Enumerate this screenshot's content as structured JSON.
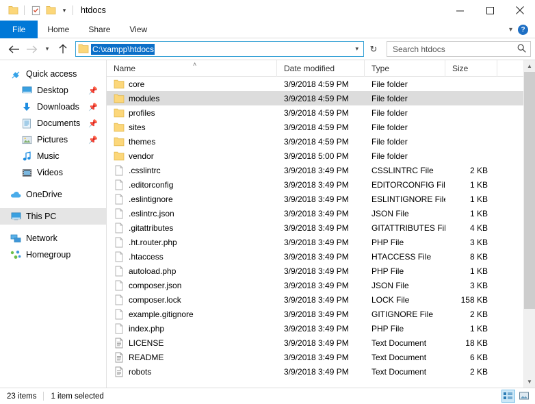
{
  "window": {
    "title": "htdocs",
    "quick_access_icons": [
      "folder-icon",
      "properties-icon",
      "new-folder-icon"
    ],
    "qat_dropdown": "chevron-down-icon",
    "controls": {
      "minimize": "—",
      "maximize": "☐",
      "close": "✕"
    }
  },
  "ribbon": {
    "tabs": [
      {
        "label": "File",
        "active": true
      },
      {
        "label": "Home",
        "active": false
      },
      {
        "label": "Share",
        "active": false
      },
      {
        "label": "View",
        "active": false
      }
    ],
    "collapse_icon": "chevron-down-icon",
    "help_icon": "?",
    "file_tab_color": "#0078d7"
  },
  "address": {
    "back_icon": "arrow-left-icon",
    "forward_icon": "arrow-right-icon",
    "recent_icon": "chevron-down-icon",
    "up_icon": "arrow-up-icon",
    "path": "C:\\xampp\\htdocs",
    "path_selected": true,
    "dropdown_icon": "chevron-down-icon",
    "refresh_icon": "↻",
    "selection_color": "#0b6fc8",
    "border_color": "#3aa3d6"
  },
  "search": {
    "placeholder": "Search htdocs",
    "icon": "search-icon"
  },
  "sidebar": {
    "items": [
      {
        "label": "Quick access",
        "icon": "pin-star-icon",
        "indent": false,
        "pinned": false,
        "selected": false
      },
      {
        "label": "Desktop",
        "icon": "desktop-icon",
        "indent": true,
        "pinned": true,
        "selected": false
      },
      {
        "label": "Downloads",
        "icon": "downloads-icon",
        "indent": true,
        "pinned": true,
        "selected": false
      },
      {
        "label": "Documents",
        "icon": "documents-icon",
        "indent": true,
        "pinned": true,
        "selected": false
      },
      {
        "label": "Pictures",
        "icon": "pictures-icon",
        "indent": true,
        "pinned": true,
        "selected": false
      },
      {
        "label": "Music",
        "icon": "music-icon",
        "indent": true,
        "pinned": false,
        "selected": false
      },
      {
        "label": "Videos",
        "icon": "videos-icon",
        "indent": true,
        "pinned": false,
        "selected": false
      },
      {
        "label": "OneDrive",
        "icon": "onedrive-icon",
        "indent": false,
        "pinned": false,
        "selected": false
      },
      {
        "label": "This PC",
        "icon": "this-pc-icon",
        "indent": false,
        "pinned": false,
        "selected": true
      },
      {
        "label": "Network",
        "icon": "network-icon",
        "indent": false,
        "pinned": false,
        "selected": false
      },
      {
        "label": "Homegroup",
        "icon": "homegroup-icon",
        "indent": false,
        "pinned": false,
        "selected": false
      }
    ]
  },
  "filelist": {
    "sort_indicator": "˄",
    "columns": [
      "Name",
      "Date modified",
      "Type",
      "Size"
    ],
    "rows": [
      {
        "name": "core",
        "date": "3/9/2018 4:59 PM",
        "type": "File folder",
        "size": "",
        "icon": "folder-icon",
        "selected": false
      },
      {
        "name": "modules",
        "date": "3/9/2018 4:59 PM",
        "type": "File folder",
        "size": "",
        "icon": "folder-icon",
        "selected": true
      },
      {
        "name": "profiles",
        "date": "3/9/2018 4:59 PM",
        "type": "File folder",
        "size": "",
        "icon": "folder-icon",
        "selected": false
      },
      {
        "name": "sites",
        "date": "3/9/2018 4:59 PM",
        "type": "File folder",
        "size": "",
        "icon": "folder-icon",
        "selected": false
      },
      {
        "name": "themes",
        "date": "3/9/2018 4:59 PM",
        "type": "File folder",
        "size": "",
        "icon": "folder-icon",
        "selected": false
      },
      {
        "name": "vendor",
        "date": "3/9/2018 5:00 PM",
        "type": "File folder",
        "size": "",
        "icon": "folder-icon",
        "selected": false
      },
      {
        "name": ".csslintrc",
        "date": "3/9/2018 3:49 PM",
        "type": "CSSLINTRC File",
        "size": "2 KB",
        "icon": "file-icon",
        "selected": false
      },
      {
        "name": ".editorconfig",
        "date": "3/9/2018 3:49 PM",
        "type": "EDITORCONFIG File",
        "size": "1 KB",
        "icon": "file-icon",
        "selected": false
      },
      {
        "name": ".eslintignore",
        "date": "3/9/2018 3:49 PM",
        "type": "ESLINTIGNORE File",
        "size": "1 KB",
        "icon": "file-icon",
        "selected": false
      },
      {
        "name": ".eslintrc.json",
        "date": "3/9/2018 3:49 PM",
        "type": "JSON File",
        "size": "1 KB",
        "icon": "file-icon",
        "selected": false
      },
      {
        "name": ".gitattributes",
        "date": "3/9/2018 3:49 PM",
        "type": "GITATTRIBUTES File",
        "size": "4 KB",
        "icon": "file-icon",
        "selected": false
      },
      {
        "name": ".ht.router.php",
        "date": "3/9/2018 3:49 PM",
        "type": "PHP File",
        "size": "3 KB",
        "icon": "file-icon",
        "selected": false
      },
      {
        "name": ".htaccess",
        "date": "3/9/2018 3:49 PM",
        "type": "HTACCESS File",
        "size": "8 KB",
        "icon": "file-icon",
        "selected": false
      },
      {
        "name": "autoload.php",
        "date": "3/9/2018 3:49 PM",
        "type": "PHP File",
        "size": "1 KB",
        "icon": "file-icon",
        "selected": false
      },
      {
        "name": "composer.json",
        "date": "3/9/2018 3:49 PM",
        "type": "JSON File",
        "size": "3 KB",
        "icon": "file-icon",
        "selected": false
      },
      {
        "name": "composer.lock",
        "date": "3/9/2018 3:49 PM",
        "type": "LOCK File",
        "size": "158 KB",
        "icon": "file-icon",
        "selected": false
      },
      {
        "name": "example.gitignore",
        "date": "3/9/2018 3:49 PM",
        "type": "GITIGNORE File",
        "size": "2 KB",
        "icon": "file-icon",
        "selected": false
      },
      {
        "name": "index.php",
        "date": "3/9/2018 3:49 PM",
        "type": "PHP File",
        "size": "1 KB",
        "icon": "file-icon",
        "selected": false
      },
      {
        "name": "LICENSE",
        "date": "3/9/2018 3:49 PM",
        "type": "Text Document",
        "size": "18 KB",
        "icon": "text-doc-icon",
        "selected": false
      },
      {
        "name": "README",
        "date": "3/9/2018 3:49 PM",
        "type": "Text Document",
        "size": "6 KB",
        "icon": "text-doc-icon",
        "selected": false
      },
      {
        "name": "robots",
        "date": "3/9/2018 3:49 PM",
        "type": "Text Document",
        "size": "2 KB",
        "icon": "text-doc-icon",
        "selected": false
      }
    ]
  },
  "status": {
    "items_count": "23 items",
    "selection": "1 item selected",
    "view_details_icon": "details-view-icon",
    "view_large_icon": "large-icons-view-icon"
  }
}
